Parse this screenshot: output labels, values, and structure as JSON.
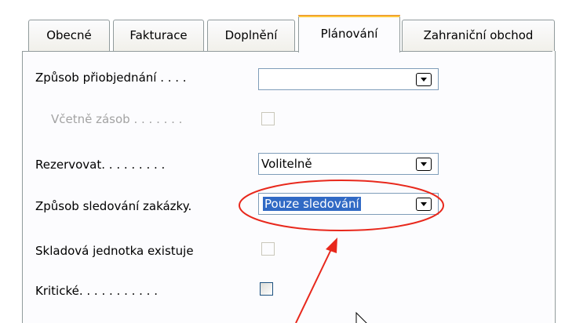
{
  "tabs": [
    {
      "label": "Obecné",
      "active": false
    },
    {
      "label": "Fakturace",
      "active": false
    },
    {
      "label": "Doplnění",
      "active": false
    },
    {
      "label": "Plánování",
      "active": true
    },
    {
      "label": "Zahraniční obchod",
      "active": false
    }
  ],
  "fields": {
    "zpusob_pri": {
      "label": "Způsob přiobjednání . . . .",
      "value": ""
    },
    "vcetne_zasob": {
      "label": "Včetně zásob . . . . . . .",
      "checked": false,
      "disabled": true
    },
    "rezervovat": {
      "label": "Rezervovat. . . . . . . . .",
      "value": "Volitelně"
    },
    "sledovani": {
      "label": "Způsob sledování zakázky.",
      "value": "Pouze sledování"
    },
    "skladova": {
      "label": "Skladová jednotka existuje",
      "checked": false,
      "disabled": true
    },
    "kriticke": {
      "label": "Kritické. . . . . . . . . . .",
      "checked": false,
      "disabled": false
    }
  },
  "colors": {
    "selection": "#316ac5",
    "annotation": "#e8281c",
    "active_tab_accent": "#ffc83c"
  },
  "icons": {
    "dropdown": "chevron-down-icon",
    "cursor": "mouse-pointer-icon"
  }
}
